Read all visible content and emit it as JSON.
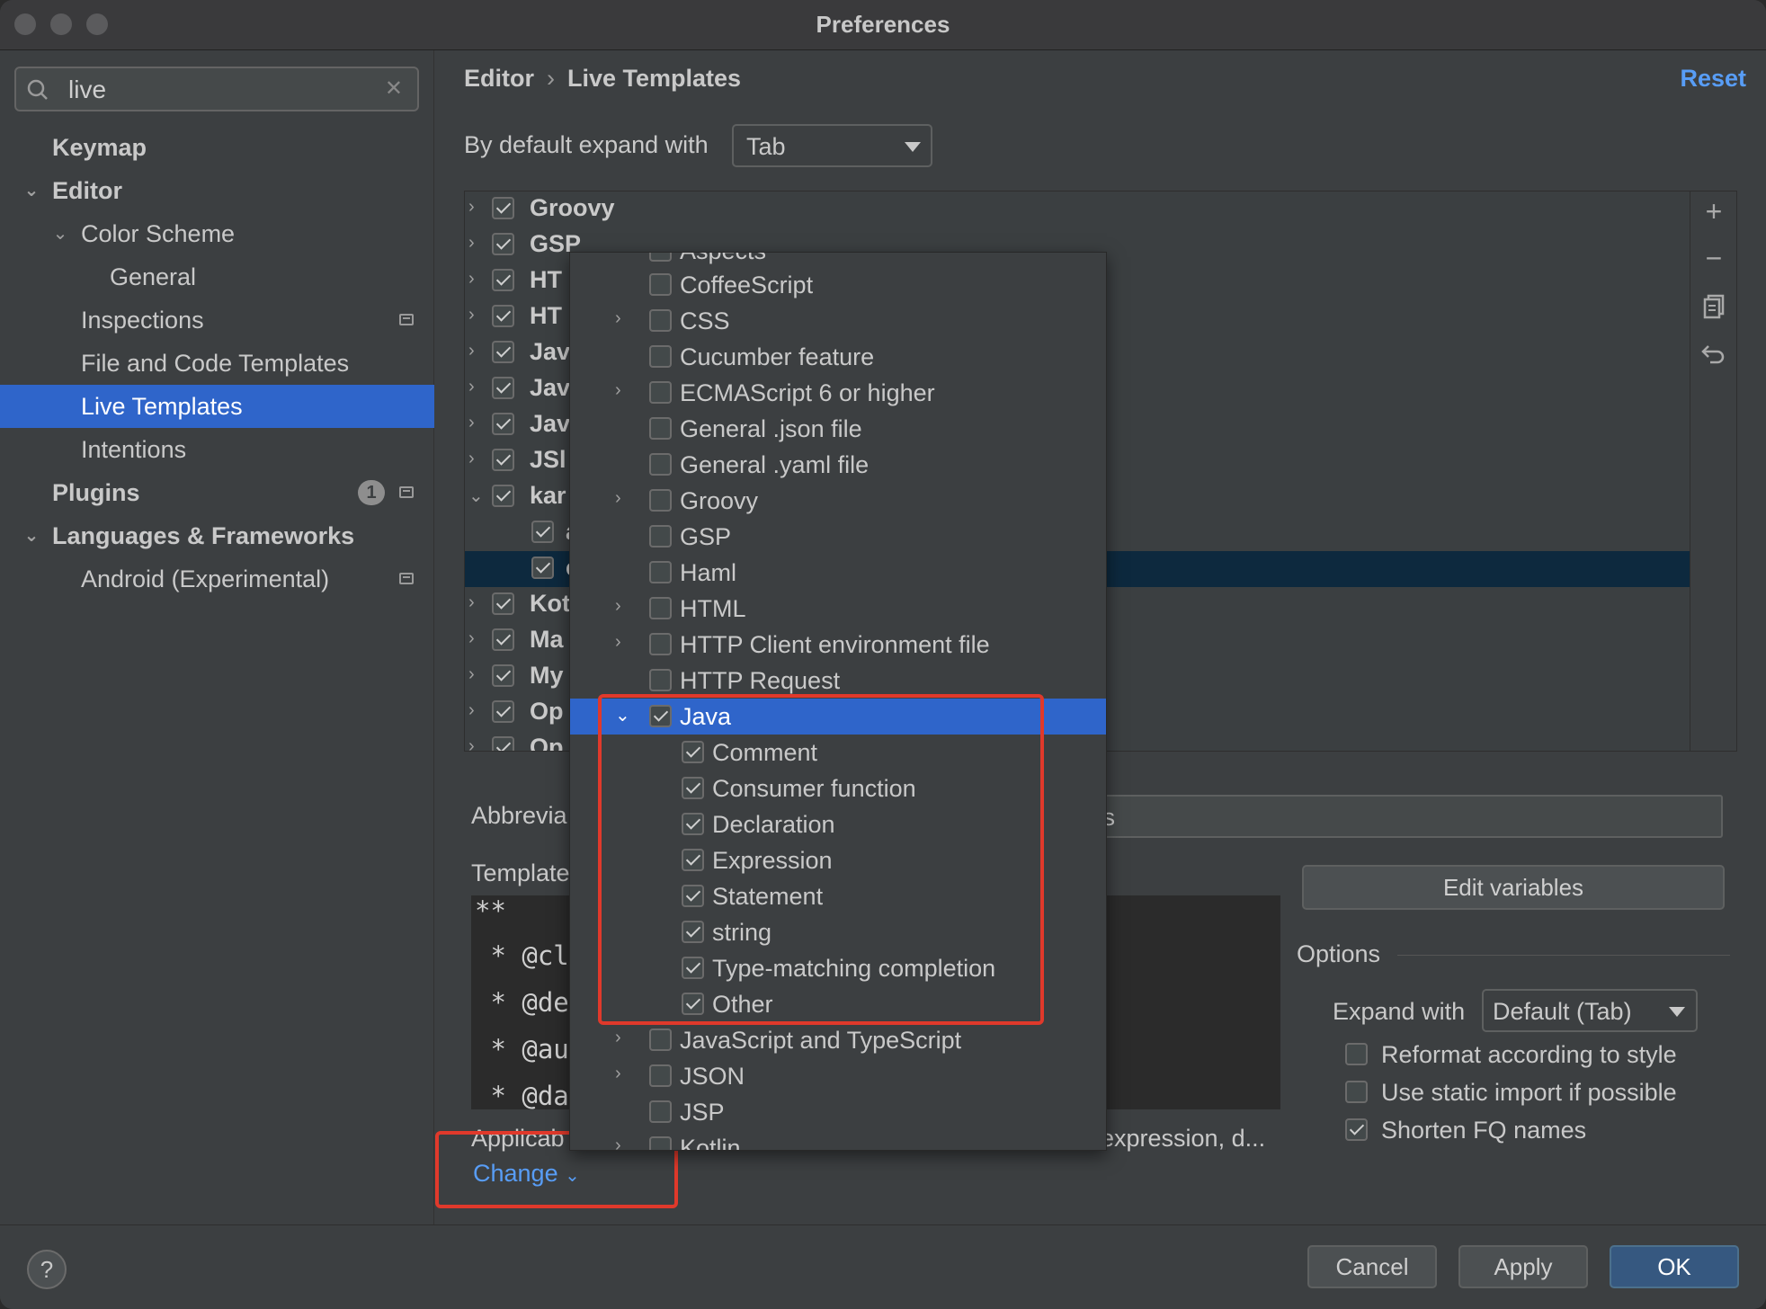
{
  "window": {
    "title": "Preferences"
  },
  "search": {
    "value": "live"
  },
  "sidebar": {
    "items": [
      {
        "label": "Keymap"
      },
      {
        "label": "Editor"
      },
      {
        "label": "Color Scheme"
      },
      {
        "label": "General"
      },
      {
        "label": "Inspections"
      },
      {
        "label": "File and Code Templates"
      },
      {
        "label": "Live Templates"
      },
      {
        "label": "Intentions"
      },
      {
        "label": "Plugins",
        "badge": "1"
      },
      {
        "label": "Languages & Frameworks"
      },
      {
        "label": "Android (Experimental)"
      }
    ]
  },
  "breadcrumb": {
    "parent": "Editor",
    "separator": "›",
    "current": "Live Templates"
  },
  "reset_label": "Reset",
  "expand_default": {
    "label": "By default expand with",
    "value": "Tab"
  },
  "template_tree": [
    {
      "label": "Groovy",
      "checked": true
    },
    {
      "label": "GSP",
      "checked": true
    },
    {
      "label": "HT",
      "checked": true
    },
    {
      "label": "HT",
      "checked": true
    },
    {
      "label": "Jav",
      "checked": true
    },
    {
      "label": "Jav",
      "checked": true
    },
    {
      "label": "Jav",
      "checked": true
    },
    {
      "label": "JSl",
      "checked": true
    },
    {
      "label": "kar",
      "checked": true,
      "expanded": true
    },
    {
      "label": "a",
      "checked": true
    },
    {
      "label": "c",
      "checked": true
    },
    {
      "label": "Kot",
      "checked": true
    },
    {
      "label": "Ma",
      "checked": true
    },
    {
      "label": "My",
      "checked": true
    },
    {
      "label": "Op",
      "checked": true
    },
    {
      "label": "Op",
      "checked": true
    }
  ],
  "toolbar": {
    "add": "+",
    "remove": "−",
    "copy": "copy-icon",
    "restore": "undo-icon"
  },
  "abbreviation": {
    "label": "Abbrevia",
    "value": "ass"
  },
  "template_text": {
    "label": "Template",
    "lines": [
      "**",
      " * @cl",
      " * @de",
      " * @au",
      " * @da"
    ]
  },
  "edit_variables_label": "Edit variables",
  "options": {
    "title": "Options",
    "expand_with_label": "Expand with",
    "expand_with_value": "Default (Tab)",
    "reformat": "Reformat according to style",
    "static_import": "Use static import if possible",
    "shorten_fq": "Shorten FQ names"
  },
  "applicable": {
    "label": "Applicab",
    "context": "expression, d...",
    "change_label": "Change"
  },
  "context_popup": [
    {
      "label": "Aspects",
      "checked": false,
      "chevron": false,
      "indent": 0
    },
    {
      "label": "CoffeeScript",
      "checked": false,
      "chevron": false,
      "indent": 0
    },
    {
      "label": "CSS",
      "checked": false,
      "chevron": true,
      "indent": 0
    },
    {
      "label": "Cucumber feature",
      "checked": false,
      "chevron": false,
      "indent": 0
    },
    {
      "label": "ECMAScript 6 or higher",
      "checked": false,
      "chevron": true,
      "indent": 0
    },
    {
      "label": "General .json file",
      "checked": false,
      "chevron": false,
      "indent": 0
    },
    {
      "label": "General .yaml file",
      "checked": false,
      "chevron": false,
      "indent": 0
    },
    {
      "label": "Groovy",
      "checked": false,
      "chevron": true,
      "indent": 0
    },
    {
      "label": "GSP",
      "checked": false,
      "chevron": false,
      "indent": 0
    },
    {
      "label": "Haml",
      "checked": false,
      "chevron": false,
      "indent": 0
    },
    {
      "label": "HTML",
      "checked": false,
      "chevron": true,
      "indent": 0
    },
    {
      "label": "HTTP Client environment file",
      "checked": false,
      "chevron": true,
      "indent": 0
    },
    {
      "label": "HTTP Request",
      "checked": false,
      "chevron": false,
      "indent": 0
    },
    {
      "label": "Java",
      "checked": true,
      "chevron": true,
      "expanded": true,
      "selected": true,
      "indent": 0
    },
    {
      "label": "Comment",
      "checked": true,
      "chevron": false,
      "indent": 1
    },
    {
      "label": "Consumer function",
      "checked": true,
      "chevron": false,
      "indent": 1
    },
    {
      "label": "Declaration",
      "checked": true,
      "chevron": false,
      "indent": 1
    },
    {
      "label": "Expression",
      "checked": true,
      "chevron": false,
      "indent": 1
    },
    {
      "label": "Statement",
      "checked": true,
      "chevron": false,
      "indent": 1
    },
    {
      "label": "string",
      "checked": true,
      "chevron": false,
      "indent": 1
    },
    {
      "label": "Type-matching completion",
      "checked": true,
      "chevron": false,
      "indent": 1
    },
    {
      "label": "Other",
      "checked": true,
      "chevron": false,
      "indent": 1
    },
    {
      "label": "JavaScript and TypeScript",
      "checked": false,
      "chevron": true,
      "indent": 0
    },
    {
      "label": "JSON",
      "checked": false,
      "chevron": true,
      "indent": 0
    },
    {
      "label": "JSP",
      "checked": false,
      "chevron": false,
      "indent": 0
    },
    {
      "label": "Kotlin",
      "checked": false,
      "chevron": true,
      "indent": 0
    }
  ],
  "footer": {
    "help": "?",
    "cancel": "Cancel",
    "apply": "Apply",
    "ok": "OK"
  },
  "colors": {
    "accent": "#2f65ca",
    "link": "#589df6",
    "annotation": "#e0392b"
  }
}
